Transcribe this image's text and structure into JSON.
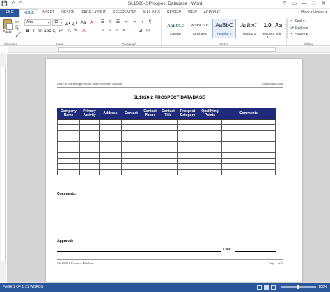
{
  "window": {
    "title": "SL1020-2 Prospect Database - Word",
    "controls": [
      "?",
      "▭",
      "—",
      "□",
      "✕"
    ]
  },
  "qat": {
    "save": "💾",
    "undo": "↶",
    "redo": "↷"
  },
  "ribbon": {
    "file_tab": "FILE",
    "tabs": [
      "HOME",
      "INSERT",
      "DESIGN",
      "PAGE LAYOUT",
      "REFERENCES",
      "MAILINGS",
      "REVIEW",
      "VIEW",
      "ACROBAT"
    ],
    "user": "Bianca Viviano ▾",
    "clipboard": {
      "paste": "Paste",
      "label": "Clipboard"
    },
    "font": {
      "name": "Arial",
      "size": "12",
      "label": "Font"
    },
    "paragraph": {
      "label": "Paragraph"
    },
    "styles": {
      "label": "Styles",
      "items": [
        {
          "sample": "AaBbCc",
          "name": "Caption"
        },
        {
          "sample": "AaBbCcDc",
          "name": "Emphasis"
        },
        {
          "sample": "AaBbC",
          "name": "Heading 1"
        },
        {
          "sample": "AaBbC",
          "name": "Heading 2"
        },
        {
          "sample": "1.0",
          "name": "Heading 3"
        },
        {
          "sample": "AaB",
          "name": "Title"
        }
      ]
    },
    "editing": {
      "find": "Find ▾",
      "replace": "Replace",
      "select": "Select ▾",
      "label": "Editing"
    }
  },
  "document": {
    "header_left": "Sales & Marketing Policies and Procedures Manual",
    "header_right": "Bizmanualz.com",
    "title": "SL1020-2 PROSPECT DATABASE",
    "table": {
      "columns": [
        "Company Name",
        "Primary Activity",
        "Address",
        "Contact",
        "Contact Phone",
        "Contact Title",
        "Prospect Category",
        "Qualifying Points",
        "Comments"
      ],
      "empty_rows": 10
    },
    "comments_label": "Comments:",
    "approval_label": "Approval:",
    "date_label": "Date",
    "footer_left": "SL 1020-2 Prospect Database",
    "footer_right": "Page 1 of 1"
  },
  "status": {
    "page": "PAGE 1 OF 1",
    "words": "21 WORDS",
    "zoom": "100%"
  },
  "colors": {
    "accent": "#2b579a",
    "table_header": "#1f2a7a"
  }
}
